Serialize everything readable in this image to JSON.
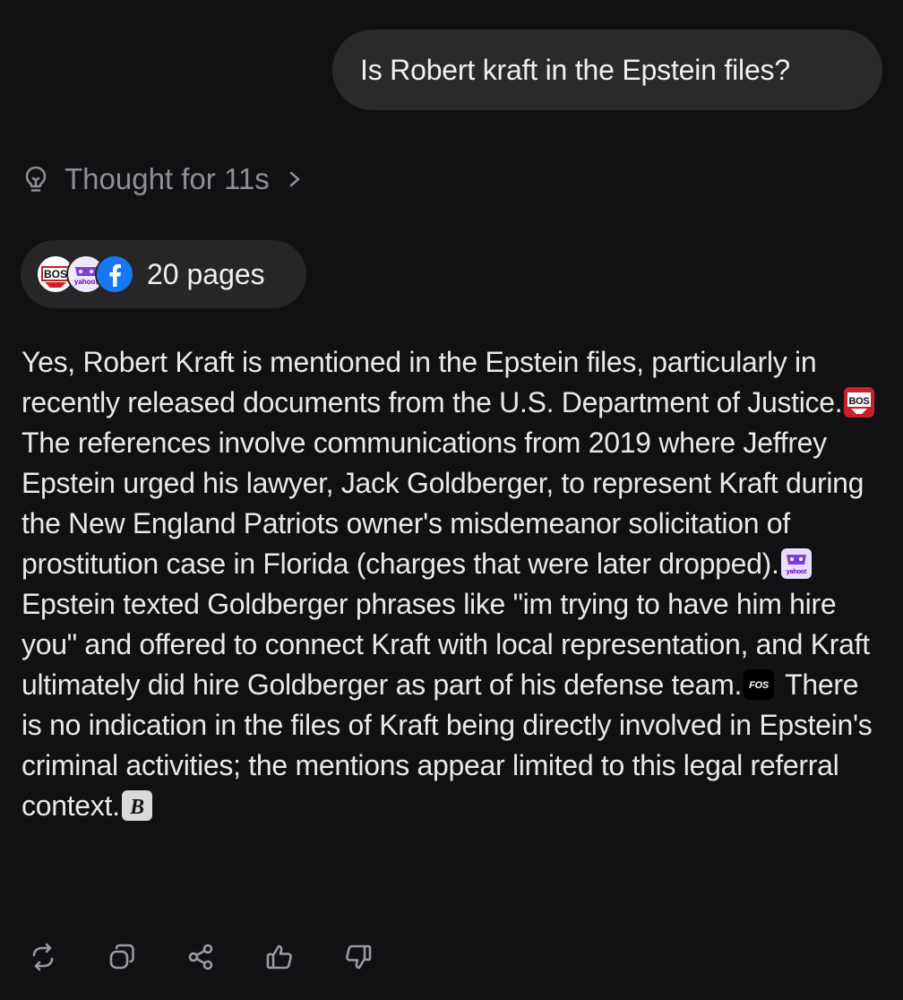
{
  "user_message": "Is Robert kraft in the Epstein files?",
  "thought": {
    "label": "Thought for 11s",
    "icon": "lightbulb-icon"
  },
  "sources": {
    "label": "20 pages",
    "favicons": [
      "bos-favicon",
      "yahoo-favicon",
      "facebook-favicon"
    ]
  },
  "answer": {
    "segments": [
      "Yes, Robert Kraft is mentioned in the Epstein files, particularly in recently released documents from the U.S. Department of Justice.",
      " The references involve communications from 2019 where Jeffrey Epstein urged his lawyer, Jack Goldberger, to represent Kraft during the New England Patriots owner's misdemeanor solicitation of prostitution case in Florida (charges that were later dropped).",
      " Epstein texted Goldberger phrases like \"im trying to have him hire you\" and offered to connect Kraft with local representation, and Kraft ultimately did hire Goldberger as part of his defense team.",
      " There is no indication in the files of Kraft being directly involved in Epstein's criminal activities; the mentions appear limited to this legal referral context."
    ],
    "citations": [
      {
        "icon": "bos-citation-icon",
        "text": "BOS"
      },
      {
        "icon": "yahoo-citation-icon",
        "text": "yahoo!"
      },
      {
        "icon": "fos-citation-icon",
        "text": "FOS"
      },
      {
        "icon": "boston-herald-citation-icon",
        "text": "B"
      }
    ]
  },
  "actions": [
    {
      "name": "regenerate",
      "icon": "refresh-icon"
    },
    {
      "name": "copy",
      "icon": "copy-icon"
    },
    {
      "name": "share",
      "icon": "share-icon"
    },
    {
      "name": "like",
      "icon": "thumbs-up-icon"
    },
    {
      "name": "dislike",
      "icon": "thumbs-down-icon"
    }
  ],
  "colors": {
    "background": "#111113",
    "bubble": "#2a2a2c",
    "muted_text": "#8e8e93",
    "facebook_blue": "#1877f2",
    "bos_red": "#c8202a",
    "yahoo_purple": "#6001d2"
  }
}
